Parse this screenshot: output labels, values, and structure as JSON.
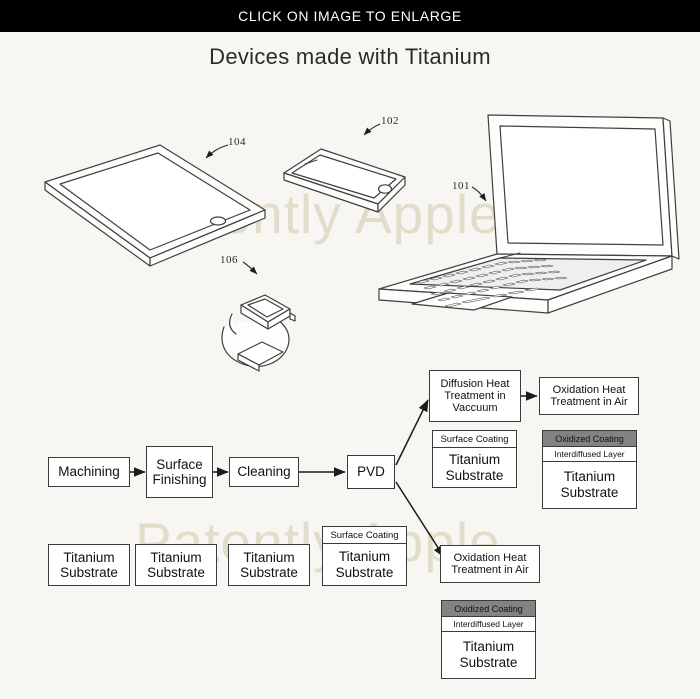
{
  "header": {
    "banner_text": "CLICK ON IMAGE TO ENLARGE",
    "background_color": "#000000",
    "text_color": "#ffffff"
  },
  "figure": {
    "title": "Devices made with Titanium",
    "background_color": "#f7f6f3",
    "watermark": {
      "text": "Patently Apple",
      "color": "#ddd9c3",
      "occurrences": 2
    },
    "devices": [
      {
        "name": "tablet",
        "ref": "104"
      },
      {
        "name": "smartphone",
        "ref": "102"
      },
      {
        "name": "laptop",
        "ref": "101"
      },
      {
        "name": "smartwatch",
        "ref": "106"
      }
    ]
  },
  "flowchart": {
    "process_steps": [
      {
        "id": "machining",
        "label": "Machining"
      },
      {
        "id": "surface-finishing",
        "label_lines": [
          "Surface",
          "Finishing"
        ]
      },
      {
        "id": "cleaning",
        "label": "Cleaning"
      },
      {
        "id": "pvd",
        "label": "PVD"
      }
    ],
    "step_labels": {
      "machining": "Machining",
      "surface_finishing_1": "Surface",
      "surface_finishing_2": "Finishing",
      "cleaning": "Cleaning",
      "pvd": "PVD"
    },
    "branch_upper": {
      "diffusion": {
        "line1": "Diffusion Heat",
        "line2": "Treatment in",
        "line3": "Vaccuum"
      },
      "oxidation": {
        "line1": "Oxidation Heat",
        "line2": "Treatment in Air"
      }
    },
    "branch_lower": {
      "oxidation": {
        "line1": "Oxidation Heat",
        "line2": "Treatment in Air"
      }
    },
    "substrate_row": [
      {
        "id": "sub-1",
        "line1": "Titanium",
        "line2": "Substrate"
      },
      {
        "id": "sub-2",
        "line1": "Titanium",
        "line2": "Substrate"
      },
      {
        "id": "sub-3",
        "line1": "Titanium",
        "line2": "Substrate"
      },
      {
        "id": "sub-4",
        "cap": "Surface Coating",
        "line1": "Titanium",
        "line2": "Substrate"
      }
    ],
    "stacks": {
      "surface_coated": {
        "cap": "Surface Coating",
        "body_line1": "Titanium",
        "body_line2": "Substrate"
      },
      "oxidized_upper": {
        "cap_dark": "Oxidized Coating",
        "cap_mid": "Interdiffused Layer",
        "body_line1": "Titanium",
        "body_line2": "Substrate",
        "dark_color": "#838383"
      },
      "oxidized_lower": {
        "cap_dark": "Oxidized Coating",
        "cap_mid": "Interdiffused Layer",
        "body_line1": "Titanium",
        "body_line2": "Substrate",
        "dark_color": "#838383"
      },
      "surface_coated_bottom": {
        "cap": "Surface Coating",
        "body_line1": "Titanium",
        "body_line2": "Substrate"
      }
    }
  },
  "refnums": {
    "tablet": "104",
    "phone": "102",
    "laptop": "101",
    "watch": "106"
  }
}
